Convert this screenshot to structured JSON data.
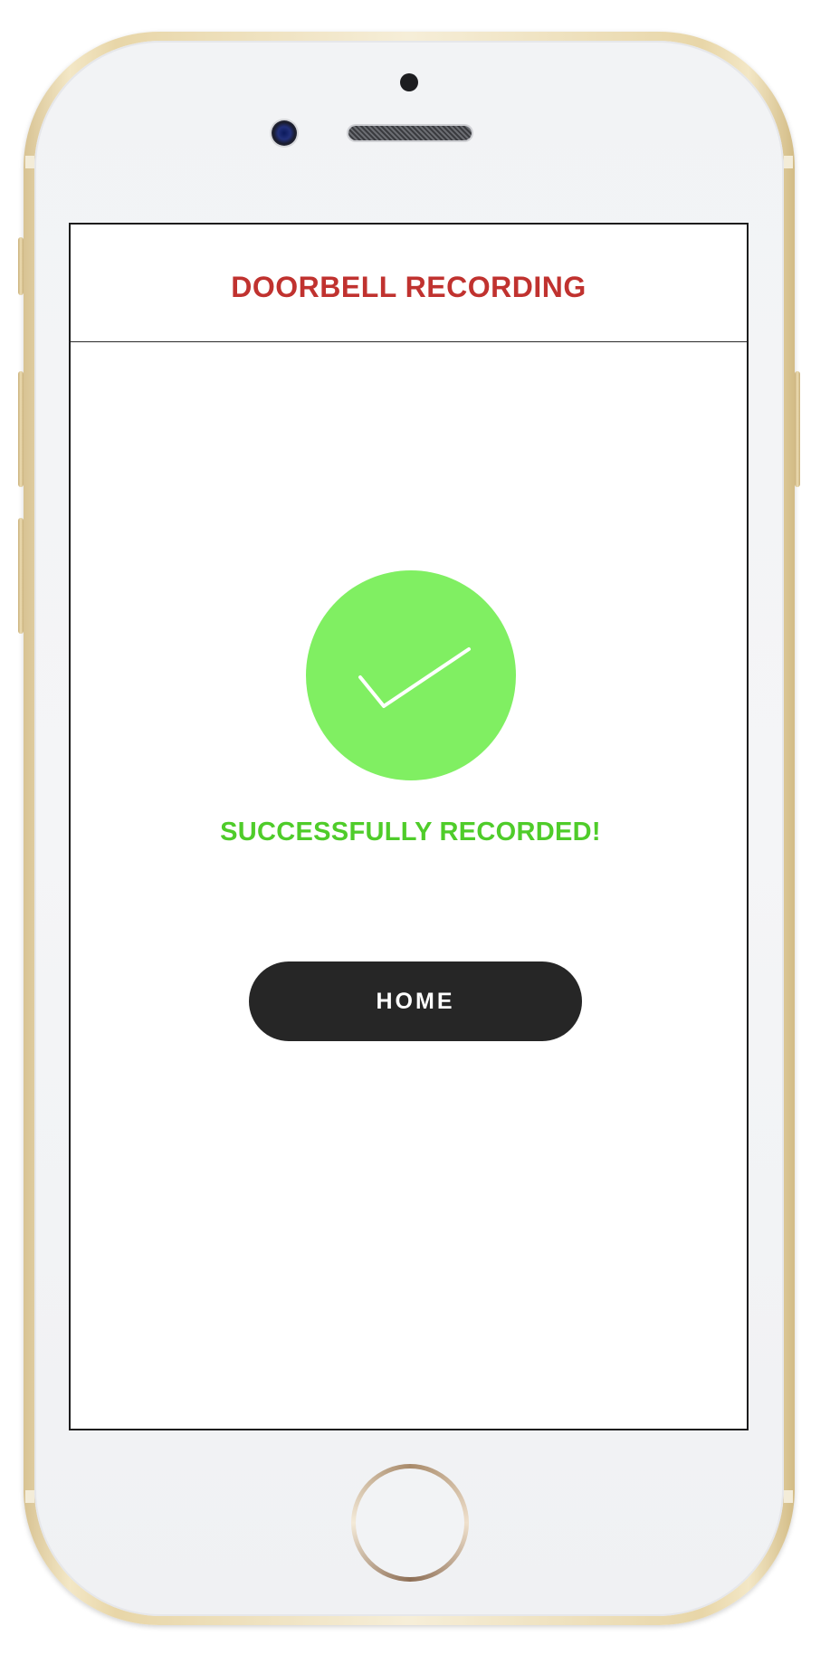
{
  "app": {
    "title": "DOORBELL RECORDING"
  },
  "status": {
    "message": "SUCCESSFULLY RECORDED!",
    "icon": "checkmark-icon"
  },
  "actions": {
    "home_label": "HOME"
  },
  "colors": {
    "title": "#c0322f",
    "success_circle": "#80ef62",
    "success_text": "#4fcc2a",
    "button_bg": "#262626",
    "button_text": "#ffffff",
    "phone_frame": "#e8d6a8"
  }
}
